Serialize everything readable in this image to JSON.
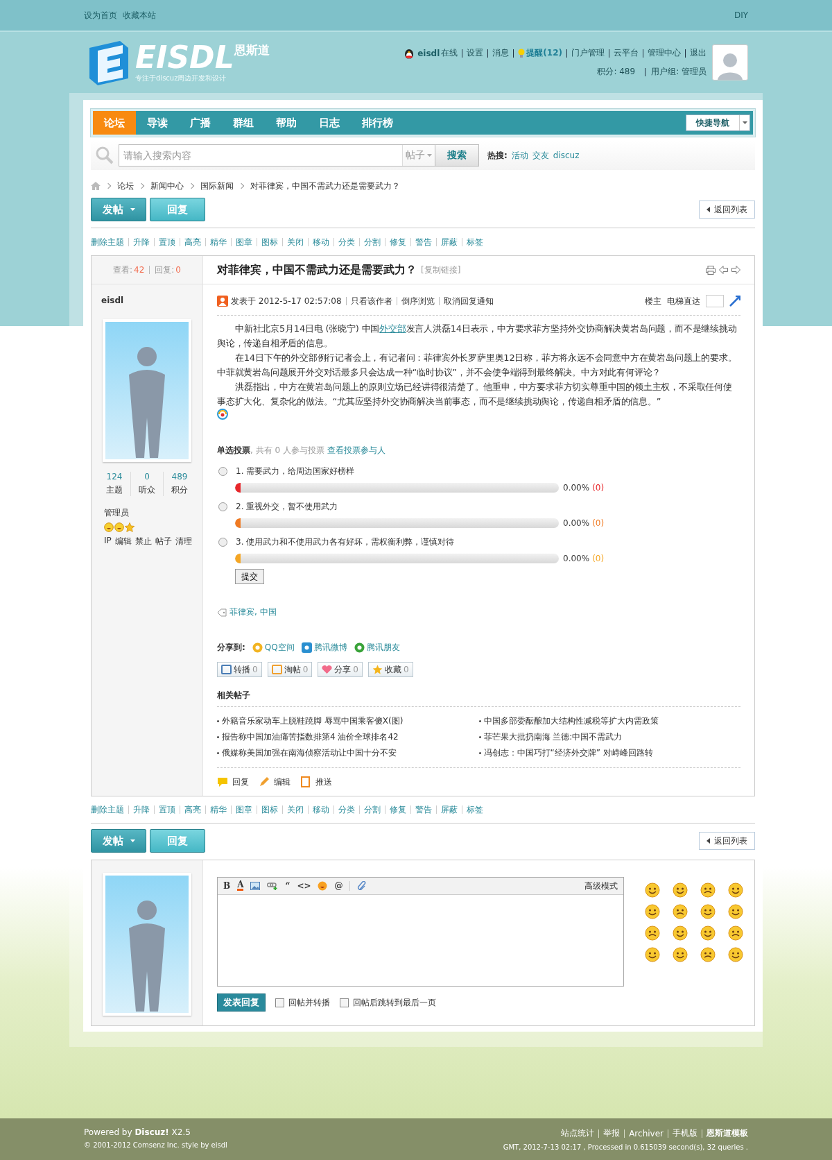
{
  "top_bar": {
    "links": [
      "设为首页",
      "收藏本站"
    ],
    "diy": "DIY"
  },
  "logo": {
    "name": "EISDL",
    "cn": "恩斯道",
    "tagline": "专注于discuz周边开发和设计"
  },
  "user_bar": {
    "username": "eisdl",
    "status": "在线",
    "links": [
      {
        "label": "设置",
        "kind": "link"
      },
      {
        "label": "消息",
        "kind": "link"
      },
      {
        "label": "提醒(12)",
        "kind": "alert"
      },
      {
        "label": "门户管理",
        "kind": "link"
      },
      {
        "label": "云平台",
        "kind": "link"
      },
      {
        "label": "管理中心",
        "kind": "link"
      },
      {
        "label": "退出",
        "kind": "link"
      }
    ],
    "points": "积分: 489",
    "group": "用户组: 管理员"
  },
  "nav": {
    "items": [
      {
        "label": "论坛",
        "selected": true
      },
      {
        "label": "导读",
        "selected": false
      },
      {
        "label": "广播",
        "selected": false
      },
      {
        "label": "群组",
        "selected": false
      },
      {
        "label": "帮助",
        "selected": false
      },
      {
        "label": "日志",
        "selected": false
      },
      {
        "label": "排行榜",
        "selected": false
      }
    ],
    "quick_nav": "快捷导航"
  },
  "search": {
    "placeholder": "请输入搜索内容",
    "scope": "帖子",
    "button": "搜索",
    "hot_label": "热搜:",
    "hot": [
      "活动",
      "交友",
      "discuz"
    ]
  },
  "breadcrumb": [
    "论坛",
    "新闻中心",
    "国际新闻",
    "对菲律宾，中国不需武力还是需要武力？"
  ],
  "actions_top": {
    "post": "发帖",
    "reply": "回复",
    "back": "返回列表"
  },
  "mod_links_top": [
    "删除主题",
    "升降",
    "置顶",
    "高亮",
    "精华",
    "图章",
    "图标",
    "关闭",
    "移动",
    "分类",
    "分割",
    "修复",
    "警告",
    "屏蔽",
    "标签"
  ],
  "thread": {
    "views_label": "查看:",
    "views": "42",
    "replies_label": "回复:",
    "replies": "0",
    "title": "对菲律宾，中国不需武力还是需要武力？",
    "copy_link": "[复制链接]"
  },
  "author": {
    "name": "eisdl",
    "stats": [
      {
        "value": "124",
        "label": "主题"
      },
      {
        "value": "0",
        "label": "听众"
      },
      {
        "value": "489",
        "label": "积分"
      }
    ],
    "group": "管理员",
    "admin_links": [
      "IP",
      "编辑",
      "禁止",
      "帖子",
      "清理"
    ]
  },
  "post": {
    "posted": "发表于 2012-5-17 02:57:08",
    "links": [
      "只看该作者",
      "倒序浏览",
      "取消回复通知"
    ],
    "floor": "楼主",
    "jump": "电梯直达",
    "paragraphs": [
      [
        {
          "kind": "text",
          "text": "中新社北京5月14日电 (张晓宁) 中国"
        },
        {
          "kind": "link",
          "text": "外交部"
        },
        {
          "kind": "text",
          "text": "发言人洪磊14日表示，中方要求菲方坚持外交协商解决黄岩岛问题，而不是继续挑动舆论，传递自相矛盾的信息。"
        }
      ],
      [
        {
          "kind": "text",
          "text": "在14日下午的外交部例行记者会上，有记者问：菲律宾外长罗萨里奥12日称，菲方将永远不会同意中方在黄岩岛问题上的要求。中菲就黄岩岛问题展开外交对话最多只会达成一种“临时协议”，并不会使争端得到最终解决。中方对此有何评论？"
        }
      ],
      [
        {
          "kind": "text",
          "text": "洪磊指出，中方在黄岩岛问题上的原则立场已经讲得很清楚了。他重申，中方要求菲方切实尊重中国的领土主权，不采取任何使事态扩大化、复杂化的做法。“尤其应坚持外交协商解决当前事态，而不是继续挑动舆论，传递自相矛盾的信息。”"
        }
      ]
    ]
  },
  "poll": {
    "type_label": "单选投票",
    "summary": ", 共有 0 人参与投票",
    "voters_link": "查看投票参与人",
    "submit": "提交",
    "options": [
      {
        "label": "1.  需要武力，给周边国家好榜样",
        "selected": false,
        "level": 0,
        "percent": "0.00%",
        "count": "(0)",
        "color": "#e8262a"
      },
      {
        "label": "2.  重视外交，暂不使用武力",
        "selected": false,
        "level": 0,
        "percent": "0.00%",
        "count": "(0)",
        "color": "#f07a22"
      },
      {
        "label": "3.  使用武力和不使用武力各有好坏，需权衡利弊，谨慎对待",
        "selected": false,
        "level": 0,
        "percent": "0.00%",
        "count": "(0)",
        "color": "#f5a623"
      }
    ]
  },
  "tags": "菲律宾, 中国",
  "share": {
    "label": "分享到:",
    "items": [
      {
        "label": "QQ空间",
        "kind": "qzone"
      },
      {
        "label": "腾讯微博",
        "kind": "weibo"
      },
      {
        "label": "腾讯朋友",
        "kind": "friends"
      }
    ]
  },
  "counters": [
    {
      "label": "转播",
      "count": "0",
      "kind": "relay"
    },
    {
      "label": "淘帖",
      "count": "0",
      "kind": "collect"
    },
    {
      "label": "分享",
      "count": "0",
      "kind": "heart"
    },
    {
      "label": "收藏",
      "count": "0",
      "kind": "star"
    }
  ],
  "related": {
    "title": "相关帖子",
    "columns": [
      [
        "外籍音乐家动车上脱鞋蹺脚 辱骂中国乘客傻X(图)",
        "报告称中国加油痛苦指数排第4 油价全球排名42",
        "俄媒称美国加强在南海侦察活动让中国十分不安"
      ],
      [
        "中国多部委酝酿加大结构性减税等扩大内需政策",
        "菲芒果大批扔南海 兰德:中国不需武力",
        "冯创志：中国巧打“经济外交牌” 对峙峰回路转"
      ]
    ]
  },
  "post_actions": [
    {
      "label": "回复",
      "kind": "reply"
    },
    {
      "label": "编辑",
      "kind": "edit"
    },
    {
      "label": "推送",
      "kind": "push"
    }
  ],
  "mod_links_bottom": [
    "删除主题",
    "升降",
    "置顶",
    "高亮",
    "精华",
    "图章",
    "图标",
    "关闭",
    "移动",
    "分类",
    "分割",
    "修复",
    "警告",
    "屏蔽",
    "标签"
  ],
  "actions_bottom": {
    "post": "发帖",
    "reply": "回复",
    "back": "返回列表"
  },
  "editor": {
    "toolbar": [
      {
        "kind": "text",
        "label": "B"
      },
      {
        "kind": "color",
        "label": "A"
      },
      {
        "kind": "image"
      },
      {
        "kind": "link"
      },
      {
        "kind": "text",
        "label": "“"
      },
      {
        "kind": "text",
        "label": "<>"
      },
      {
        "kind": "smiley"
      },
      {
        "kind": "text",
        "label": "@"
      },
      {
        "kind": "attach"
      }
    ],
    "advanced": "高级模式",
    "submit": "发表回复",
    "options": [
      {
        "label": "回帖并转播",
        "checked": false
      },
      {
        "label": "回帖后跳转到最后一页",
        "checked": false
      }
    ]
  },
  "footer": {
    "powered": "Powered by **Discuz!** X2.5",
    "copyright": "© 2001-2012 Comsenz Inc. style by eisdl",
    "links": [
      {
        "label": "站点统计",
        "bold": false
      },
      {
        "label": "举报",
        "bold": false
      },
      {
        "label": "Archiver",
        "bold": false
      },
      {
        "label": "手机版",
        "bold": false
      },
      {
        "label": "恩斯道模板",
        "bold": true
      }
    ],
    "stats": "GMT, 2012-7-13 02:17 , Processed in 0.615039 second(s), 32 queries ."
  }
}
